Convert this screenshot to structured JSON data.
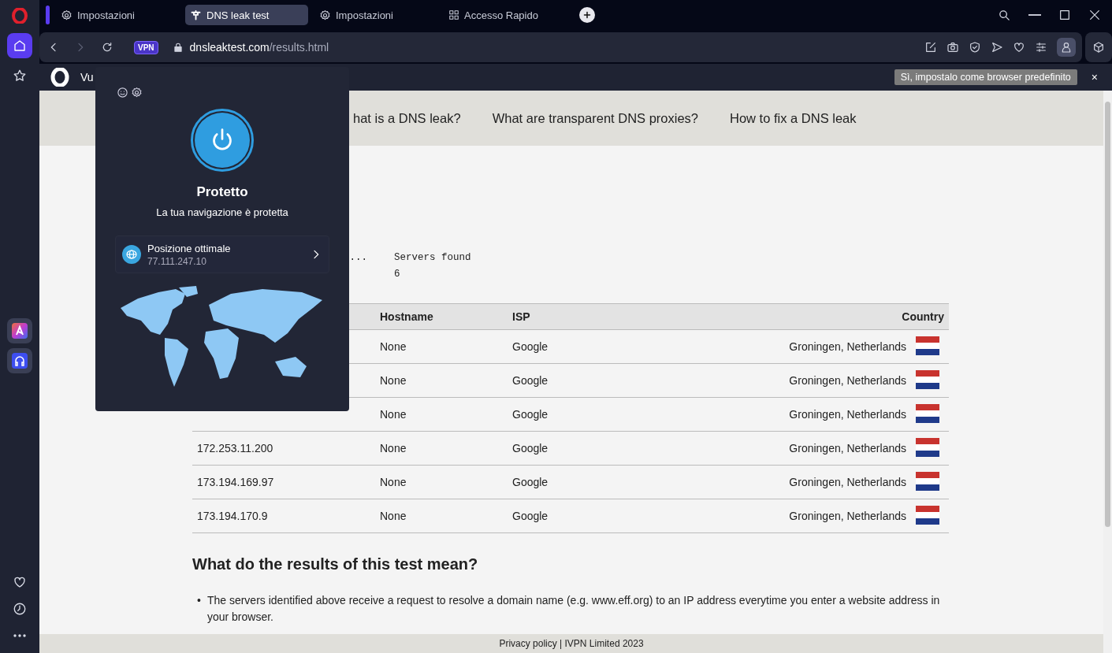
{
  "tabs": [
    {
      "kind": "gear",
      "label": "Impostazioni",
      "selected": false
    },
    {
      "kind": "tap",
      "label": "DNS leak test",
      "selected": true
    },
    {
      "kind": "gear",
      "label": "Impostazioni",
      "selected": false
    },
    {
      "kind": "grid",
      "label": "Accesso Rapido",
      "selected": false
    }
  ],
  "sidebar": {
    "top": [
      {
        "kind": "home",
        "selected": true
      },
      {
        "kind": "star",
        "selected": false
      }
    ],
    "apps": [
      {
        "kind": "aria"
      },
      {
        "kind": "music"
      }
    ],
    "bottom": [
      {
        "kind": "heart",
        "selected": false
      },
      {
        "kind": "history",
        "selected": false
      },
      {
        "kind": "more",
        "selected": false
      }
    ]
  },
  "address_bar": {
    "forward_disabled": true,
    "vpn_badge": "VPN",
    "vpn_on": true,
    "url_host": "dnsleaktest.com",
    "url_path": "/results.html"
  },
  "info_bar": {
    "text": "Vu",
    "button": "Sì, impostalo come browser predefinito",
    "close": "×"
  },
  "vpn_popup": {
    "connected": true,
    "status": "Protetto",
    "message": "La tua navigazione è protetta",
    "location": {
      "name": "Posizione ottimale",
      "ip": "77.111.247.10"
    }
  },
  "page": {
    "nav": [
      "hat is a DNS leak?",
      "What are transparent DNS proxies?",
      "How to fix a DNS leak"
    ],
    "summary": {
      "column_1": "...",
      "servers_label": "Servers found",
      "servers_count": "6"
    },
    "table": {
      "columns": [
        "Hostname",
        "ISP",
        "Country"
      ],
      "rows": [
        {
          "hostname": "None",
          "isp": "Google",
          "country": "Groningen, Netherlands"
        },
        {
          "hostname": "None",
          "isp": "Google",
          "country": "Groningen, Netherlands"
        },
        {
          "hostname": "None",
          "isp": "Google",
          "country": "Groningen, Netherlands"
        },
        {
          "ip": "172.253.11.200",
          "hostname": "None",
          "isp": "Google",
          "country": "Groningen, Netherlands"
        },
        {
          "ip": "173.194.169.97",
          "hostname": "None",
          "isp": "Google",
          "country": "Groningen, Netherlands"
        },
        {
          "ip": "173.194.170.9",
          "hostname": "None",
          "isp": "Google",
          "country": "Groningen, Netherlands"
        }
      ]
    },
    "heading": "What do the results of this test mean?",
    "bullets": [
      {
        "marker": "•",
        "text": "The servers identified above receive a request to resolve a domain name (e.g. www.eff.org) to an IP address everytime you enter a website address in your browser."
      }
    ],
    "footer": "Privacy policy | IVPN Limited 2023"
  }
}
